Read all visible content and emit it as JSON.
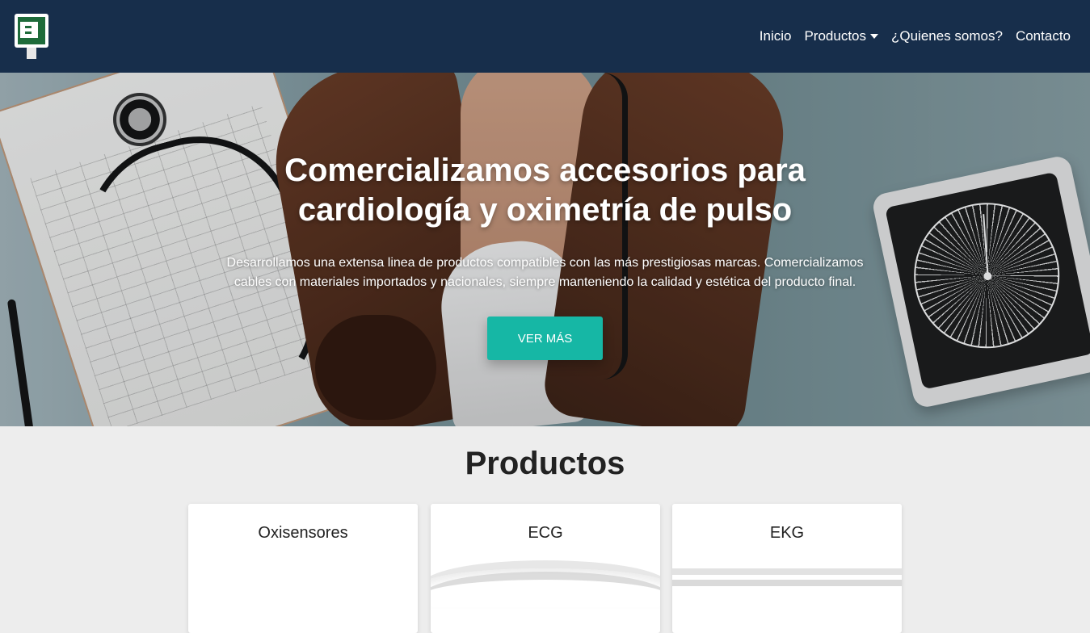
{
  "nav": {
    "items": [
      {
        "label": "Inicio"
      },
      {
        "label": "Productos"
      },
      {
        "label": "¿Quienes somos?"
      },
      {
        "label": "Contacto"
      }
    ]
  },
  "hero": {
    "title": "Comercializamos accesorios para cardiología y oximetría de pulso",
    "text": "Desarrollamos una extensa linea de productos compatibles con las más prestigiosas marcas. Comercializamos cables con materiales importados y nacionales, siempre manteniendo la calidad y estética del producto final.",
    "button": "VER MÁS",
    "accent_color": "#16b7a5"
  },
  "products": {
    "title": "Productos",
    "cards": [
      {
        "title": "Oxisensores"
      },
      {
        "title": "ECG"
      },
      {
        "title": "EKG"
      }
    ]
  }
}
